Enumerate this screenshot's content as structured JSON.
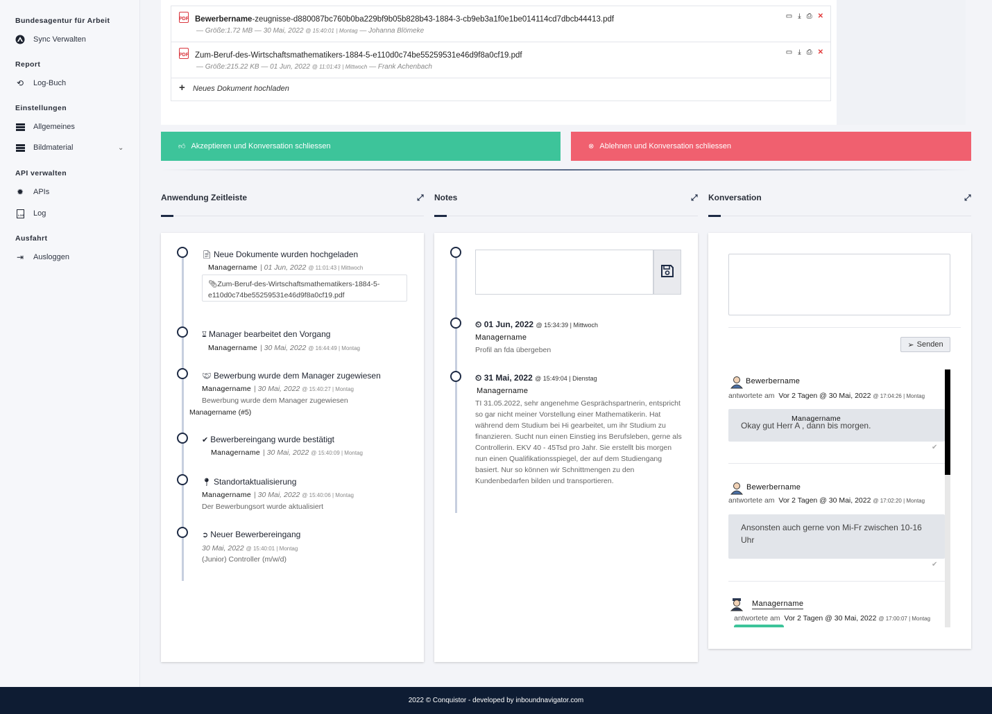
{
  "sidebar": {
    "org_label": "Bundesagentur für Arbeit",
    "sync_label": "Sync Verwalten",
    "report_label": "Report",
    "logbook_label": "Log-Buch",
    "settings_label": "Einstellungen",
    "general_label": "Allgemeines",
    "images_label": "Bildmaterial",
    "api_section_label": "API verwalten",
    "apis_label": "APIs",
    "log_label": "Log",
    "exit_label": "Ausfahrt",
    "logout_label": "Ausloggen"
  },
  "documents": {
    "items": [
      {
        "name_bold": "Bewerbername",
        "name_rest": "-zeugnisse-d880087bc760b0ba229bf9b05b828b43-1884-3-cb9eb3a1f0e1be014114cd7dbcb44413.pdf",
        "meta": "— Größe:1.72 MB — 30 Mai, 2022",
        "time": "@ 15:40:01",
        "day": "| Montag",
        "author": "— Johanna Blömeke"
      },
      {
        "name_bold": "",
        "name_rest": "Zum-Beruf-des-Wirtschaftsmathematikers-1884-5-e110d0c74be55259531e46d9f8a0cf19.pdf",
        "meta": "— Größe:215.22 KB — 01 Jun, 2022",
        "time": "@ 11:01:43",
        "day": "| Mittwoch",
        "author": "— Frank Achenbach"
      }
    ],
    "upload_label": "Neues Dokument hochladen"
  },
  "actions": {
    "accept_label": "Akzeptieren und Konversation schliessen",
    "reject_label": "Ablehnen und Konversation schliessen"
  },
  "timeline": {
    "header": "Anwendung Zeitleiste",
    "events": [
      {
        "title": "Neue Dokumente wurden hochgeladen",
        "manager": "Managername",
        "date": "| 01 Jun, 2022",
        "time": "@ 11:01:43 | Mittwoch",
        "attachment": "Zum-Beruf-des-Wirtschaftsmathematikers-1884-5-e110d0c74be55259531e46d9f8a0cf19.pdf"
      },
      {
        "title": "Manager bearbeitet den Vorgang",
        "manager": "Managername",
        "date": "| 30 Mai, 2022",
        "time": "@ 16:44:49 | Montag"
      },
      {
        "title": "Bewerbung wurde dem Manager zugewiesen",
        "manager": "Managername",
        "date": "| 30 Mai, 2022",
        "time": "@ 15:40:27 | Montag",
        "text": "Bewerbung wurde dem Manager zugewiesen",
        "extra": "Managername (#5)"
      },
      {
        "title": "Bewerbereingang wurde bestätigt",
        "manager": "Managername",
        "date": "| 30 Mai, 2022",
        "time": "@ 15:40:09 | Montag"
      },
      {
        "title": "Standortaktualisierung",
        "manager": "Managername",
        "date": "| 30 Mai, 2022",
        "time": "@ 15:40:06 | Montag",
        "text": "Der Bewerbungsort wurde aktualisiert"
      },
      {
        "title": "Neuer Bewerbereingang",
        "manager": "",
        "date": "30 Mai, 2022",
        "time": "@ 15:40:01 | Montag",
        "text": "(Junior) Controller (m/w/d)"
      }
    ]
  },
  "notes": {
    "header": "Notes",
    "entries": [
      {
        "date": "01 Jun, 2022",
        "time": "@ 15:34:39 | Mittwoch",
        "manager": "Managername",
        "text": "Profil an fda übergeben"
      },
      {
        "date": "31 Mai, 2022",
        "time": "@ 15:49:04 | Dienstag",
        "manager": "Managername",
        "text": "TI 31.05.2022, sehr angenehme Gesprächspartnerin, entspricht so gar nicht meiner Vorstellung einer Mathematikerin. Hat während dem Studium bei Hi gearbeitet, um ihr Studium zu finanzieren. Sucht nun einen Einstieg ins Berufsleben, gerne als Controllerin. EKV 40 - 45Tsd pro Jahr. Sie erstellt bis morgen nun einen Qualifikationsspiegel, der auf dem Studiengang basiert. Nur so können wir Schnittmengen zu den Kundenbedarfen bilden und transportieren."
      }
    ]
  },
  "conversation": {
    "header": "Konversation",
    "send_label": "Senden",
    "messages": [
      {
        "sender": "Bewerbername",
        "prefix": "antwortete am",
        "when": "Vor 2 Tagen @ 30 Mai, 2022",
        "time": "@ 17:04:26 | Montag",
        "text": "Okay gut Herr A                , dann bis morgen.",
        "overlay": "Managername"
      },
      {
        "sender": "Bewerbername",
        "prefix": "antwortete am",
        "when": "Vor 2 Tagen @ 30 Mai, 2022",
        "time": "@ 17:02:20 | Montag",
        "text": "Ansonsten auch gerne von Mi-Fr zwischen 10-16 Uhr"
      },
      {
        "sender": "Managername",
        "prefix": "antwortete am",
        "when": "Vor 2 Tagen @ 30 Mai, 2022",
        "time": "@ 17:00:07 | Montag"
      }
    ]
  },
  "footer": {
    "text": "2022 © Conquistor - developed by inboundnavigator.com"
  },
  "colors": {
    "accept": "#3dc49a",
    "reject": "#f0606f",
    "navy": "#0e1c33"
  }
}
